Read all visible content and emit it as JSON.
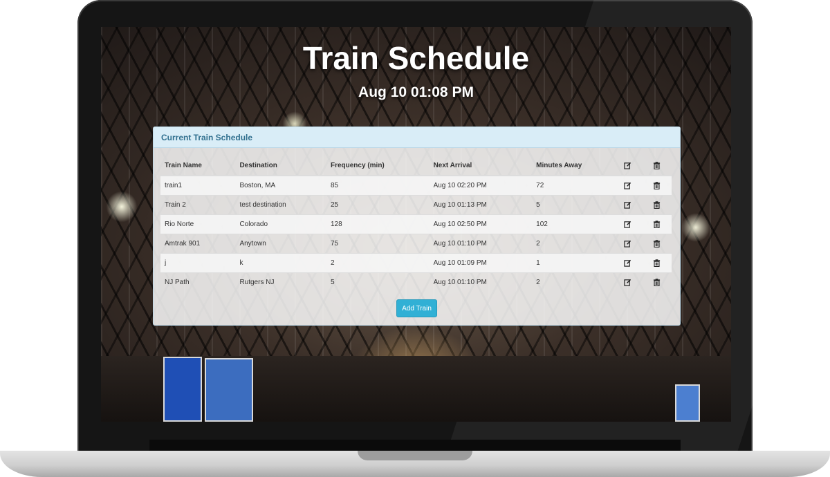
{
  "page": {
    "title": "Train Schedule",
    "current_time": "Aug 10 01:08 PM"
  },
  "panel": {
    "heading": "Current Train Schedule",
    "columns": [
      "Train Name",
      "Destination",
      "Frequency (min)",
      "Next Arrival",
      "Minutes Away"
    ],
    "rows": [
      {
        "name": "train1",
        "destination": "Boston, MA",
        "frequency": "85",
        "next_arrival": "Aug 10 02:20 PM",
        "minutes_away": "72"
      },
      {
        "name": "Train 2",
        "destination": "test destination",
        "frequency": "25",
        "next_arrival": "Aug 10 01:13 PM",
        "minutes_away": "5"
      },
      {
        "name": "Rio Norte",
        "destination": "Colorado",
        "frequency": "128",
        "next_arrival": "Aug 10 02:50 PM",
        "minutes_away": "102"
      },
      {
        "name": "Amtrak 901",
        "destination": "Anytown",
        "frequency": "75",
        "next_arrival": "Aug 10 01:10 PM",
        "minutes_away": "2"
      },
      {
        "name": "j",
        "destination": "k",
        "frequency": "2",
        "next_arrival": "Aug 10 01:09 PM",
        "minutes_away": "1"
      },
      {
        "name": "NJ Path",
        "destination": "Rutgers NJ",
        "frequency": "5",
        "next_arrival": "Aug 10 01:10 PM",
        "minutes_away": "2"
      }
    ],
    "add_button_label": "Add Train"
  },
  "icons": {
    "edit": "edit-icon",
    "delete": "trash-icon"
  },
  "colors": {
    "panel_heading_bg": "#d9edf7",
    "panel_heading_text": "#31708f",
    "button_bg": "#31b0d5"
  }
}
